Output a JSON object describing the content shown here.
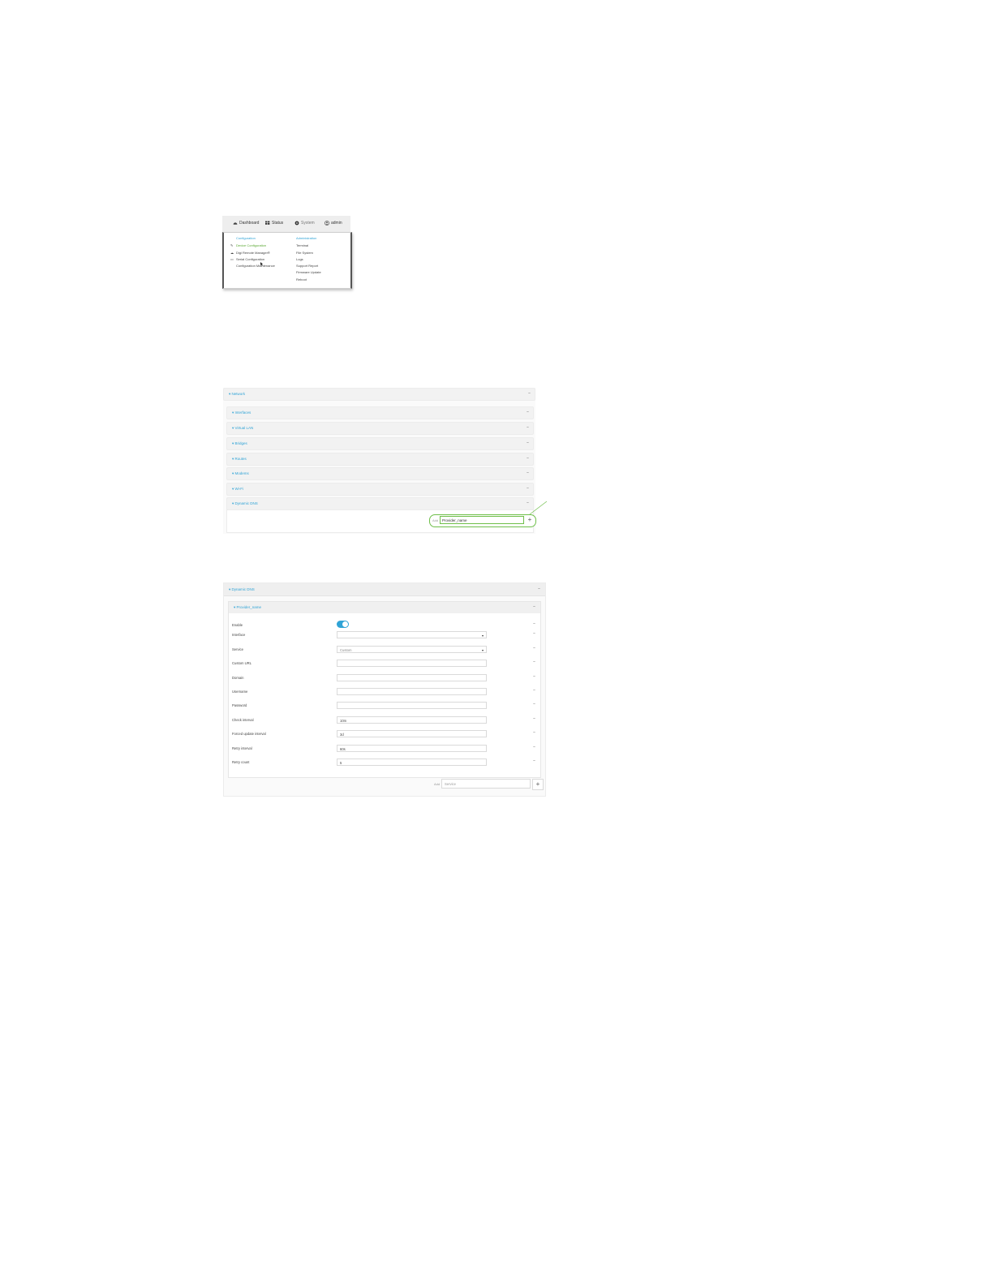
{
  "nav": {
    "dashboard": "Dashboard",
    "status": "Status",
    "system": "System",
    "admin": "admin"
  },
  "menu": {
    "configuration_header": "Configuration",
    "administration_header": "Administration",
    "configuration_items": [
      {
        "label": "Device Configuration",
        "icon": "wrench-icon"
      },
      {
        "label": "Digi Remote Manager®",
        "icon": "cloud-icon"
      },
      {
        "label": "Serial Configuration",
        "icon": "serial-icon"
      },
      {
        "label": "Configuration Maintenance",
        "icon": ""
      }
    ],
    "administration_items": [
      "Terminal",
      "File System",
      "Logs",
      "Support Report",
      "Firmware Update",
      "Reboot"
    ]
  },
  "network": {
    "title": "Network",
    "sections": [
      "Interfaces",
      "Virtual LAN",
      "Bridges",
      "Routes",
      "Modems",
      "Wi-Fi",
      "Dynamic DNS"
    ],
    "add_label": "Add",
    "add_value": "Provider_name"
  },
  "ddns": {
    "title": "Dynamic DNS",
    "provider_title": "Provider_name",
    "fields": [
      {
        "label": "Enable",
        "type": "toggle",
        "value": "on"
      },
      {
        "label": "Interface",
        "type": "select",
        "value": ""
      },
      {
        "label": "Service",
        "type": "select",
        "value": "Custom"
      },
      {
        "label": "Custom URL",
        "type": "text",
        "value": ""
      },
      {
        "label": "Domain",
        "type": "text",
        "value": ""
      },
      {
        "label": "Username",
        "type": "text",
        "value": ""
      },
      {
        "label": "Password",
        "type": "text",
        "value": ""
      },
      {
        "label": "Check interval",
        "type": "text",
        "value": "10m"
      },
      {
        "label": "Forced update interval",
        "type": "text",
        "value": "3d"
      },
      {
        "label": "Retry interval",
        "type": "text",
        "value": "60s"
      },
      {
        "label": "Retry count",
        "type": "text",
        "value": "5"
      }
    ],
    "add_label": "Add",
    "add_placeholder": "Service"
  },
  "collapse_glyph": "−",
  "expand_glyph": "▾",
  "plus_glyph": "+",
  "colors": {
    "accent": "#2fa3d6",
    "highlight": "#6fbf4a"
  }
}
